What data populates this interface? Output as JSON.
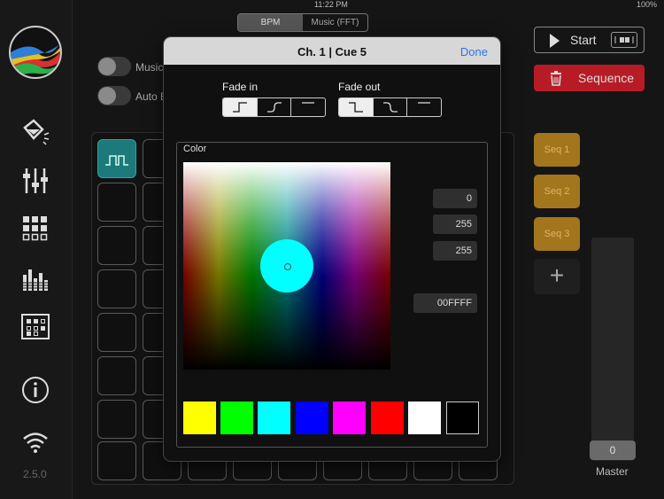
{
  "statusbar": {
    "time": "11:22 PM",
    "battery": "100%"
  },
  "sidebar": {
    "icons": [
      "paint-bucket-icon",
      "sliders-icon",
      "grid-icon",
      "equalizer-icon",
      "calendar-grid-icon",
      "info-icon",
      "wifi-icon"
    ],
    "version": "2.5.0"
  },
  "top_segment": {
    "options": [
      "BPM",
      "Music (FFT)"
    ],
    "selected": "BPM"
  },
  "toggles": [
    {
      "label": "Music"
    },
    {
      "label": "Auto B"
    }
  ],
  "controls": {
    "start_label": "Start",
    "sequence_label": "Sequence",
    "sequences": [
      "Seq 1",
      "Seq 2",
      "Seq 3"
    ],
    "add_label": "+",
    "master_value": "0",
    "master_label": "Master"
  },
  "modal": {
    "title": "Ch. 1 | Cue 5",
    "done_label": "Done",
    "fade_in_label": "Fade in",
    "fade_out_label": "Fade out",
    "fade_in_selected": 0,
    "fade_out_selected": 0,
    "color_label": "Color",
    "rgb": [
      "0",
      "255",
      "255"
    ],
    "hex": "00FFFF",
    "selected_color": "#00FFFF",
    "swatches": [
      "#FFFF00",
      "#00FF00",
      "#00FFFF",
      "#0000FF",
      "#FF00FF",
      "#FF0000",
      "#FFFFFF",
      "#000000"
    ]
  },
  "colors": {
    "accent": "#2B76E5",
    "sequence_red": "#B71C26",
    "seq_gold": "#A3761D",
    "cue_teal": "#1C7A7A"
  }
}
